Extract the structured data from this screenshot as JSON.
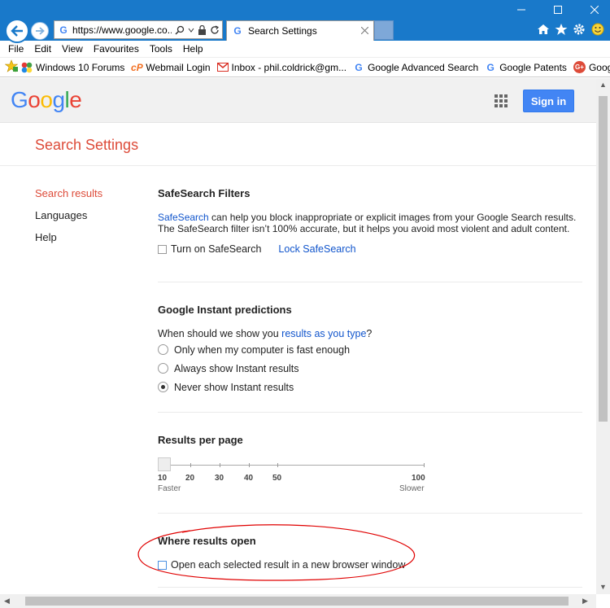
{
  "browser": {
    "address_url": "https://www.google.co...",
    "tab_title": "Search Settings"
  },
  "menu": [
    "File",
    "Edit",
    "View",
    "Favourites",
    "Tools",
    "Help"
  ],
  "favourites": [
    {
      "label": "Windows 10 Forums",
      "icon": "windows-flag-icon"
    },
    {
      "label": "Webmail Login",
      "icon": "cpanel-icon"
    },
    {
      "label": "Inbox - phil.coldrick@gm...",
      "icon": "gmail-icon"
    },
    {
      "label": "Google Advanced Search",
      "icon": "google-g-icon"
    },
    {
      "label": "Google Patents",
      "icon": "google-g-icon"
    },
    {
      "label": "Google+",
      "icon": "google-plus-icon"
    }
  ],
  "header": {
    "logo": "Google",
    "signin": "Sign in"
  },
  "page_title": "Search Settings",
  "sidebar": [
    {
      "label": "Search results"
    },
    {
      "label": "Languages"
    },
    {
      "label": "Help"
    }
  ],
  "safesearch": {
    "title": "SafeSearch Filters",
    "link": "SafeSearch",
    "description": " can help you block inappropriate or explicit images from your Google Search results. The SafeSearch filter isn’t 100% accurate, but it helps you avoid most violent and adult content.",
    "checkbox_label": "Turn on SafeSearch",
    "lock_link": "Lock SafeSearch"
  },
  "instant": {
    "title": "Google Instant predictions",
    "question_prefix": "When should we show you ",
    "question_link": "results as you type",
    "question_suffix": "?",
    "options": [
      {
        "label": "Only when my computer is fast enough",
        "selected": false
      },
      {
        "label": "Always show Instant results",
        "selected": false
      },
      {
        "label": "Never show Instant results",
        "selected": true
      }
    ]
  },
  "results_per_page": {
    "title": "Results per page",
    "ticks": [
      "10",
      "20",
      "30",
      "40",
      "50",
      "100"
    ],
    "value": 10,
    "min_label": "Faster",
    "max_label": "Slower"
  },
  "where_open": {
    "title": "Where results open",
    "checkbox_label": "Open each selected result in a new browser window"
  },
  "colors": {
    "ie_chrome": "#1979ca",
    "google_red": "#dd4b39",
    "link": "#1155cc",
    "signin_blue": "#4285f4",
    "annotation_red": "#e00000"
  }
}
